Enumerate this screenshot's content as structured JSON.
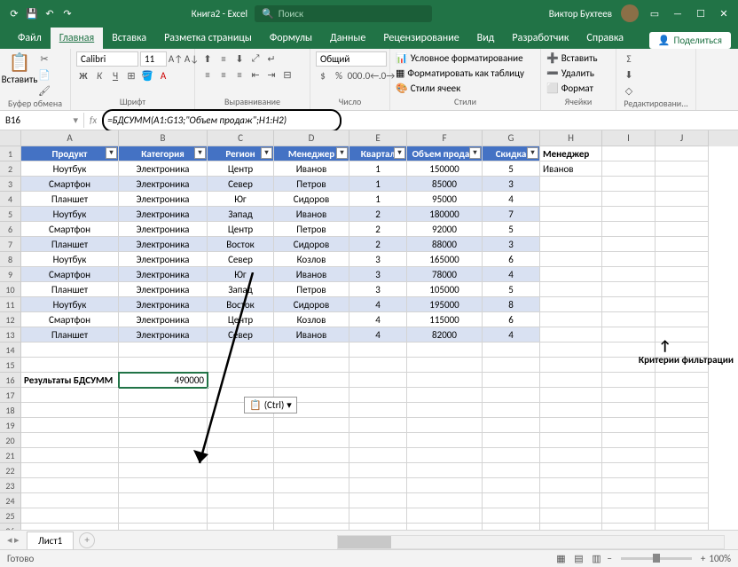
{
  "titlebar": {
    "doc_title": "Книга2 - Excel",
    "search_placeholder": "Поиск",
    "user_name": "Виктор Бухтеев"
  },
  "tabs": {
    "file": "Файл",
    "home": "Главная",
    "insert": "Вставка",
    "layout": "Разметка страницы",
    "formulas": "Формулы",
    "data": "Данные",
    "review": "Рецензирование",
    "view": "Вид",
    "developer": "Разработчик",
    "help": "Справка",
    "share": "Поделиться"
  },
  "ribbon": {
    "paste": "Вставить",
    "clipboard": "Буфер обмена",
    "font_name": "Calibri",
    "font_size": "11",
    "font_group": "Шрифт",
    "align_group": "Выравнивание",
    "num_format": "Общий",
    "number_group": "Число",
    "cond_format": "Условное форматирование",
    "format_table": "Форматировать как таблицу",
    "cell_styles": "Стили ячеек",
    "styles_group": "Стили",
    "insert_cells": "Вставить",
    "delete_cells": "Удалить",
    "format_cells": "Формат",
    "cells_group": "Ячейки",
    "edit_group": "Редактировани..."
  },
  "namebox": "B16",
  "formula": "=БДСУММ(A1:G13;\"Объем продаж\";H1:H2)",
  "headers": [
    "Продукт",
    "Категория",
    "Регион",
    "Менеджер",
    "Квартал",
    "Объем продаж",
    "Скидка"
  ],
  "criteria_header": "Менеджер",
  "criteria_value": "Иванов",
  "rows": [
    [
      "Ноутбук",
      "Электроника",
      "Центр",
      "Иванов",
      "1",
      "150000",
      "5"
    ],
    [
      "Смартфон",
      "Электроника",
      "Север",
      "Петров",
      "1",
      "85000",
      "3"
    ],
    [
      "Планшет",
      "Электроника",
      "Юг",
      "Сидоров",
      "1",
      "95000",
      "4"
    ],
    [
      "Ноутбук",
      "Электроника",
      "Запад",
      "Иванов",
      "2",
      "180000",
      "7"
    ],
    [
      "Смартфон",
      "Электроника",
      "Центр",
      "Петров",
      "2",
      "92000",
      "5"
    ],
    [
      "Планшет",
      "Электроника",
      "Восток",
      "Сидоров",
      "2",
      "88000",
      "3"
    ],
    [
      "Ноутбук",
      "Электроника",
      "Север",
      "Козлов",
      "3",
      "165000",
      "6"
    ],
    [
      "Смартфон",
      "Электроника",
      "Юг",
      "Иванов",
      "3",
      "78000",
      "4"
    ],
    [
      "Планшет",
      "Электроника",
      "Запад",
      "Петров",
      "3",
      "105000",
      "5"
    ],
    [
      "Ноутбук",
      "Электроника",
      "Восток",
      "Сидоров",
      "4",
      "195000",
      "8"
    ],
    [
      "Смартфон",
      "Электроника",
      "Центр",
      "Козлов",
      "4",
      "115000",
      "6"
    ],
    [
      "Планшет",
      "Электроника",
      "Север",
      "Иванов",
      "4",
      "82000",
      "4"
    ]
  ],
  "result_label": "Результаты БДСУММ",
  "result_value": "490000",
  "paste_hint": "(Ctrl)",
  "criterion_annotation": "Критерии фильтрации",
  "sheet": "Лист1",
  "status": "Готово",
  "zoom": "100%",
  "col_letters": [
    "A",
    "B",
    "C",
    "D",
    "E",
    "F",
    "G",
    "H",
    "I",
    "J"
  ]
}
